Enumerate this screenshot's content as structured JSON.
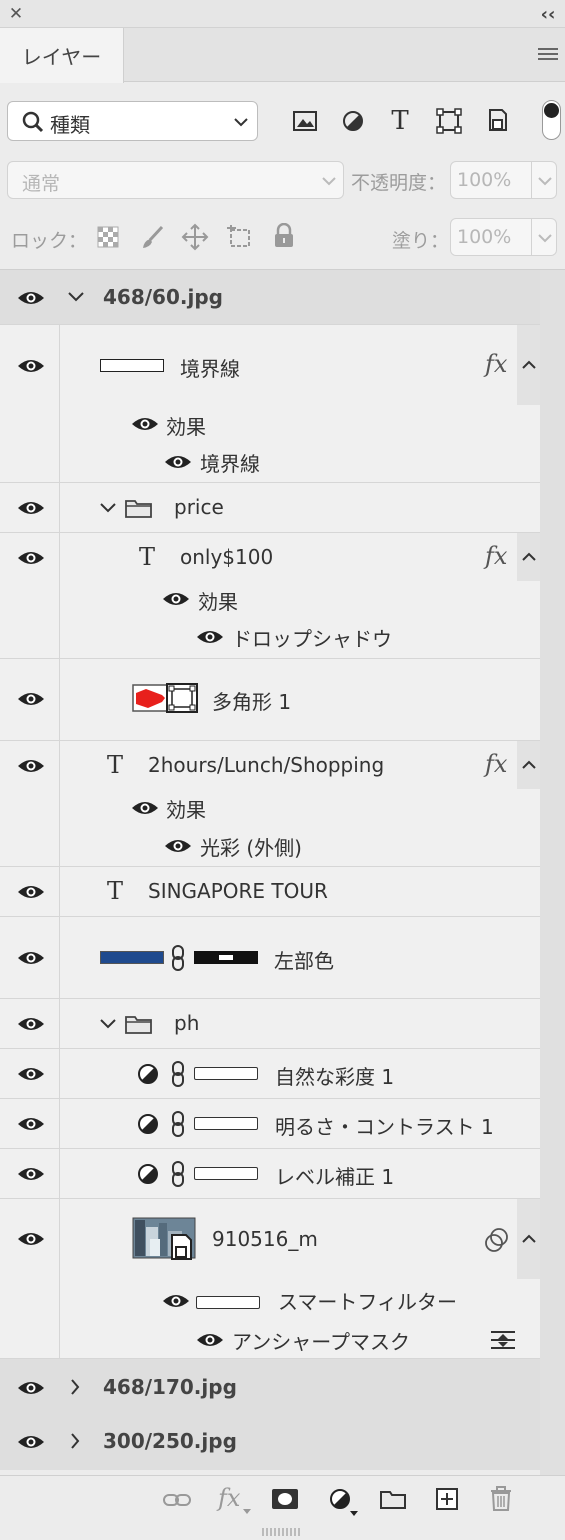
{
  "window": {
    "close_glyph": "✕",
    "collapse_glyph": "‹‹"
  },
  "panel": {
    "tab_label": "レイヤー",
    "menu_icon": "hamburger-icon"
  },
  "filter": {
    "selected": "種類",
    "icons": [
      "image-icon",
      "adjustment-icon",
      "type-icon",
      "shape-icon",
      "smart-object-icon"
    ]
  },
  "blend": {
    "mode": "通常",
    "opacity_label": "不透明度：",
    "opacity_value": "100%"
  },
  "lock": {
    "label": "ロック：",
    "fill_label": "塗り：",
    "fill_value": "100%"
  },
  "layers": {
    "group1": "468/60.jpg",
    "border": {
      "name": "境界線",
      "fx": "fx",
      "effects": "効果",
      "effect1": "境界線"
    },
    "price": "price",
    "only": {
      "name": "only$100",
      "fx": "fx",
      "effects": "効果",
      "effect1": "ドロップシャドウ"
    },
    "poly": "多角形 1",
    "hours": {
      "name": "2hours/Lunch/Shopping",
      "fx": "fx",
      "effects": "効果",
      "effect1": "光彩 (外側)"
    },
    "tour": "SINGAPORE TOUR",
    "left": "左部色",
    "ph": "ph",
    "adj1": "自然な彩度 1",
    "adj2": "明るさ・コントラスト 1",
    "adj3": "レベル補正 1",
    "smart": {
      "name": "910516_m",
      "filters": "スマートフィルター",
      "filter1": "アンシャープマスク"
    },
    "group2": "468/170.jpg",
    "group3": "300/250.jpg"
  },
  "colors": {
    "poly_fill": "#e8201c",
    "left_fill": "#1f4a8e",
    "selected_group": "#dedede"
  }
}
